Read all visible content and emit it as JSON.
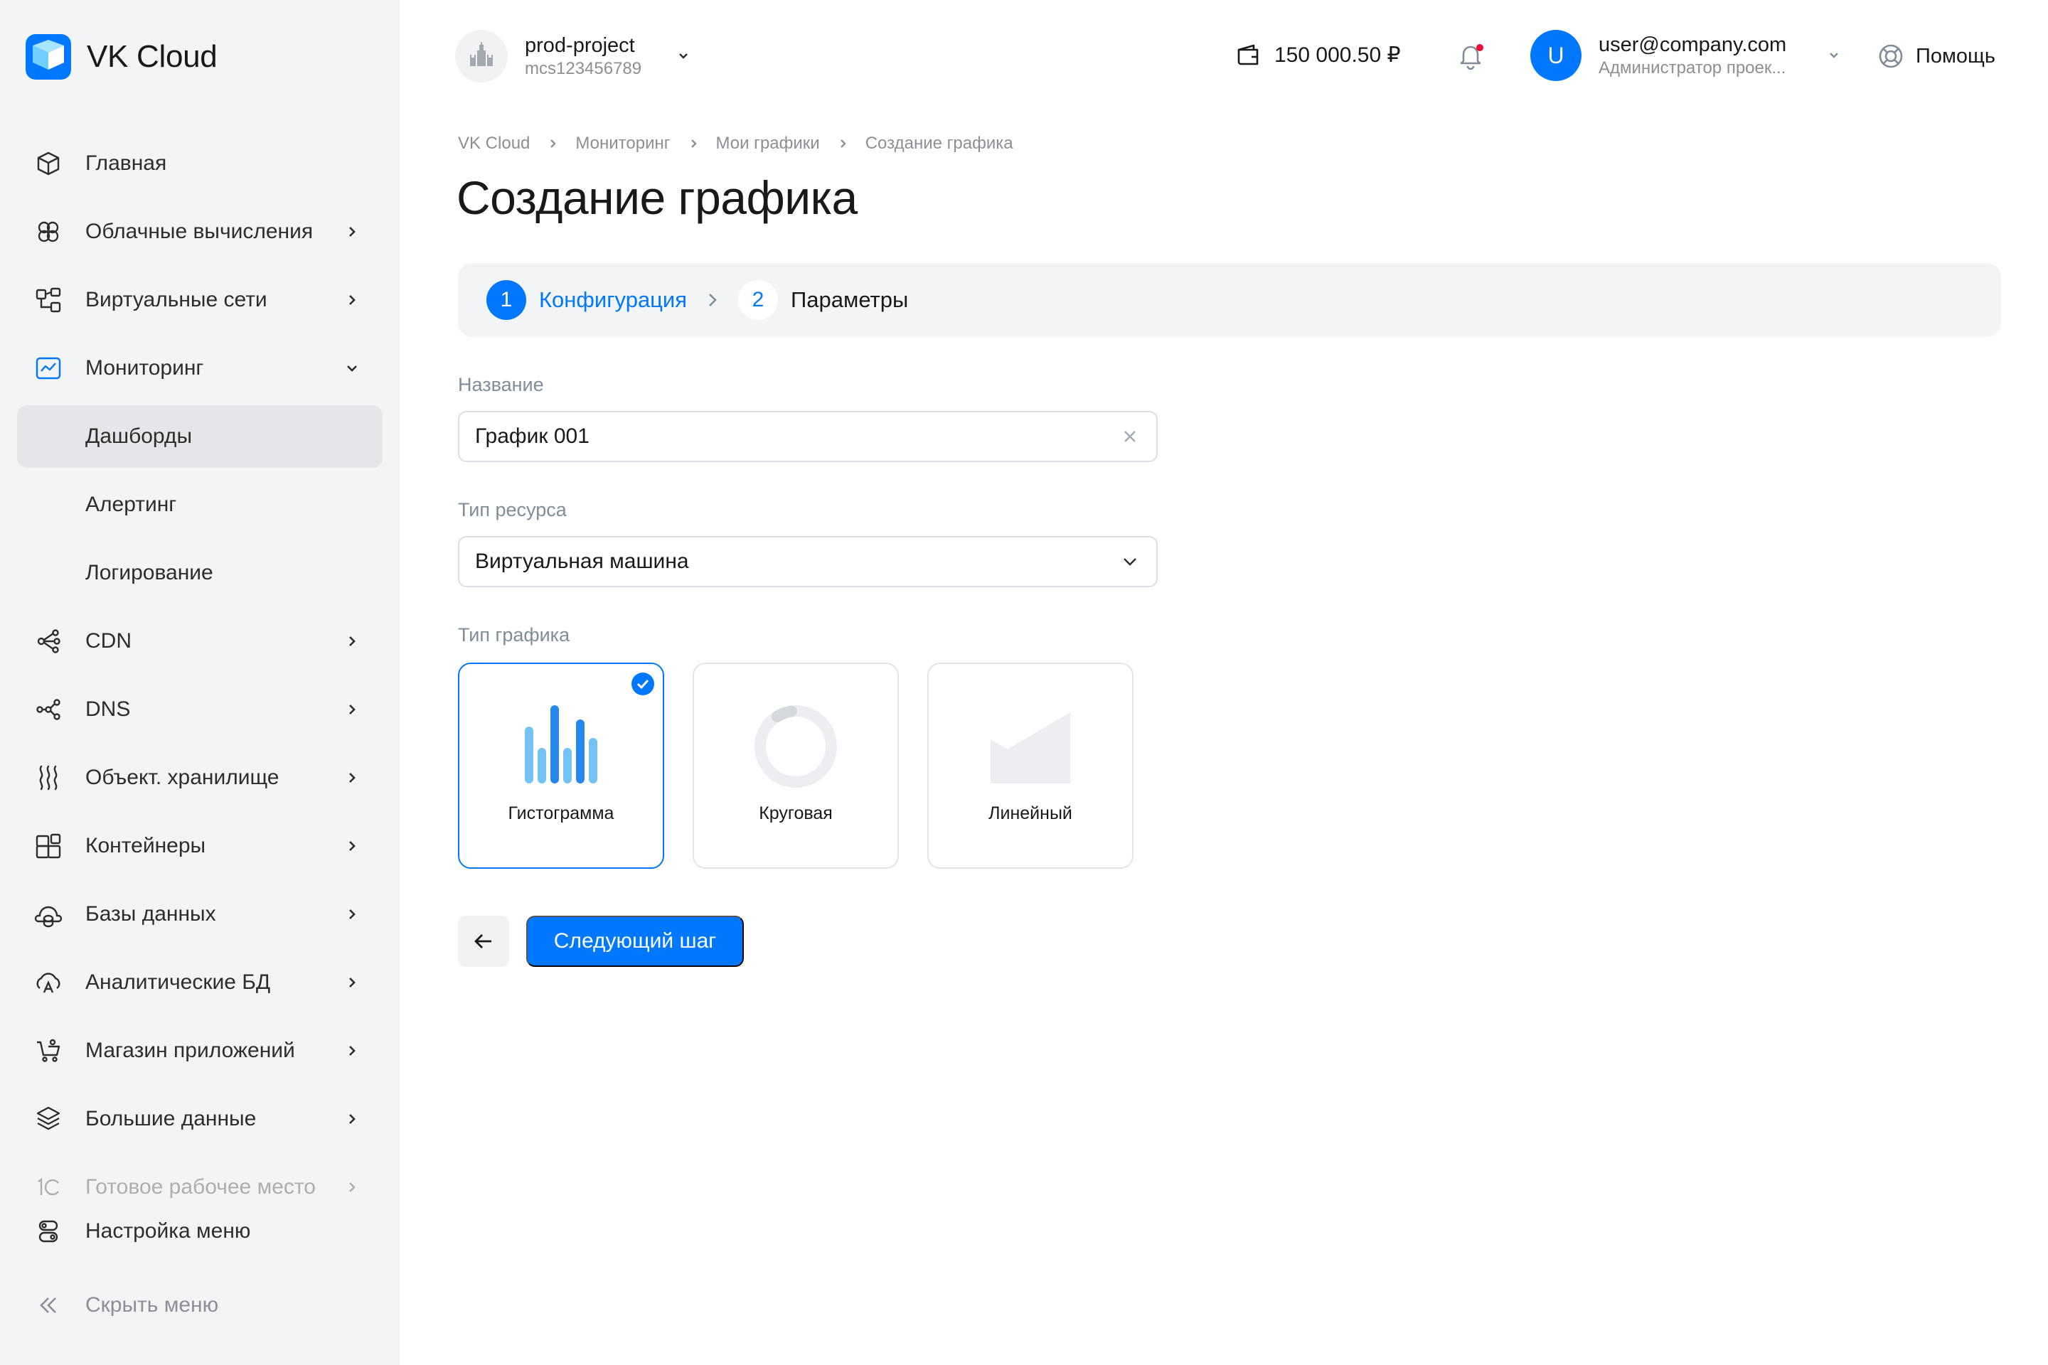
{
  "sidebar": {
    "logo_text": "VK Cloud",
    "items": [
      {
        "label": "Главная",
        "icon": "cube-icon"
      },
      {
        "label": "Облачные вычисления",
        "icon": "cloud-compute-icon"
      },
      {
        "label": "Виртуальные сети",
        "icon": "network-icon"
      },
      {
        "label": "Мониторинг",
        "icon": "monitoring-icon"
      },
      {
        "label": "Дашборды"
      },
      {
        "label": "Алертинг"
      },
      {
        "label": "Логирование"
      },
      {
        "label": "CDN",
        "icon": "cdn-icon"
      },
      {
        "label": "DNS",
        "icon": "dns-icon"
      },
      {
        "label": "Объект. хранилище",
        "icon": "object-storage-icon"
      },
      {
        "label": "Контейнеры",
        "icon": "containers-icon"
      },
      {
        "label": "Базы данных",
        "icon": "database-icon"
      },
      {
        "label": "Аналитические БД",
        "icon": "analytics-db-icon"
      },
      {
        "label": "Магазин приложений",
        "icon": "cart-icon"
      },
      {
        "label": "Большие данные",
        "icon": "layers-icon"
      },
      {
        "label": "Готовое рабочее место",
        "icon": "1c-icon"
      }
    ],
    "menu_settings": "Настройка меню",
    "hide_menu": "Скрыть меню"
  },
  "header": {
    "project_name": "prod-project",
    "project_id": "mcs123456789",
    "balance": "150 000.50 ₽",
    "user_initial": "U",
    "user_email": "user@company.com",
    "user_role": "Администратор проек...",
    "help": "Помощь"
  },
  "breadcrumb": [
    "VK Cloud",
    "Мониторинг",
    "Мои графики",
    "Создание графика"
  ],
  "page_title": "Создание графика",
  "stepper": {
    "steps": [
      {
        "num": "1",
        "label": "Конфигурация"
      },
      {
        "num": "2",
        "label": "Параметры"
      }
    ]
  },
  "form": {
    "name_label": "Название",
    "name_value": "График 001",
    "resource_label": "Тип ресурса",
    "resource_value": "Виртуальная машина",
    "chart_type_label": "Тип графика",
    "chart_types": [
      {
        "label": "Гистограмма",
        "selected": true,
        "icon": "histogram-icon"
      },
      {
        "label": "Круговая",
        "selected": false,
        "icon": "pie-chart-icon"
      },
      {
        "label": "Линейный",
        "selected": false,
        "icon": "line-chart-icon"
      }
    ]
  },
  "actions": {
    "next_label": "Следующий шаг"
  },
  "colors": {
    "accent": "#0077ff",
    "sidebar_bg": "#f3f4f6",
    "active_item_bg": "#e4e6ea"
  }
}
